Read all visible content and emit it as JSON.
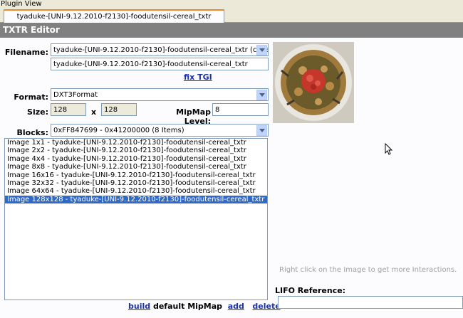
{
  "window": {
    "title": "Plugin View"
  },
  "tab": {
    "label": "tyaduke-[UNI-9.12.2010-f2130]-foodutensil-cereal_txtr"
  },
  "editor": {
    "header": "TXTR Editor",
    "filename_label": "Filename:",
    "filename_select": "tyaduke-[UNI-9.12.2010-f2130]-foodutensil-cereal_txtr (cImageDa",
    "filename_value": "tyaduke-[UNI-9.12.2010-f2130]-foodutensil-cereal_txtr",
    "fix_tgi": "fix TGI",
    "format_label": "Format:",
    "format_value": "DXT3Format",
    "size_label": "Size:",
    "width": "128",
    "x_sep": "x",
    "height": "128",
    "mipmap_label": "MipMap Level:",
    "mipmap_value": "8",
    "blocks_label": "Blocks:",
    "blocks_value": "0xFF847699 - 0x41200000 (8 Items)"
  },
  "images": [
    "Image 1x1 - tyaduke-[UNI-9.12.2010-f2130]-foodutensil-cereal_txtr",
    "Image 2x2 - tyaduke-[UNI-9.12.2010-f2130]-foodutensil-cereal_txtr",
    "Image 4x4 - tyaduke-[UNI-9.12.2010-f2130]-foodutensil-cereal_txtr",
    "Image 8x8 - tyaduke-[UNI-9.12.2010-f2130]-foodutensil-cereal_txtr",
    "Image 16x16 - tyaduke-[UNI-9.12.2010-f2130]-foodutensil-cereal_txtr",
    "Image 32x32 - tyaduke-[UNI-9.12.2010-f2130]-foodutensil-cereal_txtr",
    "Image 64x64 - tyaduke-[UNI-9.12.2010-f2130]-foodutensil-cereal_txtr",
    "Image 128x128 - tyaduke-[UNI-9.12.2010-f2130]-foodutensil-cereal_txtr"
  ],
  "selected_image_index": 7,
  "actions": {
    "build": "build",
    "default_mipmap": "default MipMap",
    "add": "add",
    "delete": "delete"
  },
  "preview": {
    "hint": "Right click on the Image to get more Interactions.",
    "lifo_label": "LIFO Reference:",
    "lifo_value": ""
  },
  "icons": {
    "dropdown": "chevron-down-icon",
    "cursor": "mouse-pointer-icon"
  },
  "colors": {
    "header": "#808080",
    "selection": "#316ac5",
    "link": "#1c32a8",
    "tab_accent": "#e68b2c"
  }
}
